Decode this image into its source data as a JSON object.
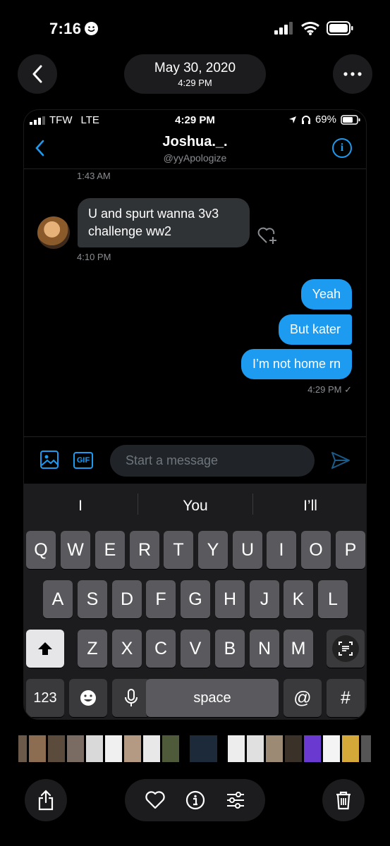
{
  "os_status": {
    "time": "7:16"
  },
  "viewer": {
    "date": "May 30, 2020",
    "time": "4:29 PM"
  },
  "inner_status": {
    "carrier": "TFW",
    "network": "LTE",
    "time": "4:29 PM",
    "battery": "69%"
  },
  "chat": {
    "name": "Joshua._.",
    "handle": "@yyApologize",
    "timestamps": {
      "first": "1:43 AM",
      "incoming": "4:10 PM",
      "outgoing": "4:29 PM ✓"
    },
    "messages_in": [
      {
        "text": "U and spurt wanna 3v3 challenge ww2"
      }
    ],
    "messages_out": [
      {
        "text": "Yeah"
      },
      {
        "text": "But kater"
      },
      {
        "text": "I’m not home rn"
      }
    ]
  },
  "composer": {
    "placeholder": "Start a message",
    "gif_label": "GIF"
  },
  "keyboard": {
    "suggestions": [
      "I",
      "You",
      "I’ll"
    ],
    "row1": [
      "Q",
      "W",
      "E",
      "R",
      "T",
      "Y",
      "U",
      "I",
      "O",
      "P"
    ],
    "row2": [
      "A",
      "S",
      "D",
      "F",
      "G",
      "H",
      "J",
      "K",
      "L"
    ],
    "row3": [
      "Z",
      "X",
      "C",
      "V",
      "B",
      "N",
      "M"
    ],
    "numbers_key": "123",
    "space_key": "space",
    "at_key": "@",
    "hash_key": "#"
  }
}
